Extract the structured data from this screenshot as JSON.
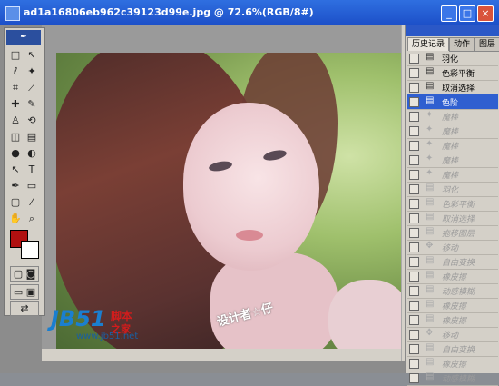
{
  "window": {
    "title": "ad1a16806eb962c39123d99e.jpg @ 72.6%(RGB/8#)",
    "controls": [
      "_",
      "□",
      "×"
    ]
  },
  "photo": {
    "signature": "设计者☆仔"
  },
  "toolbox": {
    "tools": [
      "marquee-tool",
      "move-tool",
      "lasso-tool",
      "magic-wand-tool",
      "crop-tool",
      "slice-tool",
      "healing-brush-tool",
      "brush-tool",
      "clone-stamp-tool",
      "history-brush-tool",
      "eraser-tool",
      "gradient-tool",
      "blur-tool",
      "dodge-tool",
      "path-select-tool",
      "type-tool",
      "pen-tool",
      "shape-tool",
      "notes-tool",
      "eyedropper-tool",
      "hand-tool",
      "zoom-tool"
    ],
    "glyphs": [
      "□",
      "↖",
      "ℓ",
      "✦",
      "⌗",
      "⟋",
      "✚",
      "✎",
      "♙",
      "⟲",
      "◫",
      "▤",
      "●",
      "◐",
      "↖",
      "T",
      "✒",
      "▭",
      "▢",
      "⁄",
      "✋",
      "⌕"
    ],
    "foreground_color": "#b01010",
    "background_color": "#ffffff"
  },
  "panel": {
    "tabs": [
      "历史记录",
      "动作",
      "图层"
    ],
    "history": [
      {
        "label": "羽化",
        "state": "normal"
      },
      {
        "label": "色彩平衡",
        "state": "normal"
      },
      {
        "label": "取消选择",
        "state": "normal"
      },
      {
        "label": "色阶",
        "state": "selected"
      },
      {
        "label": "魔棒",
        "state": "dim"
      },
      {
        "label": "魔棒",
        "state": "dim"
      },
      {
        "label": "魔棒",
        "state": "dim"
      },
      {
        "label": "魔棒",
        "state": "dim"
      },
      {
        "label": "魔棒",
        "state": "dim"
      },
      {
        "label": "羽化",
        "state": "dim"
      },
      {
        "label": "色彩平衡",
        "state": "dim"
      },
      {
        "label": "取消选择",
        "state": "dim"
      },
      {
        "label": "拖移图层",
        "state": "dim"
      },
      {
        "label": "移动",
        "state": "dim"
      },
      {
        "label": "自由变换",
        "state": "dim"
      },
      {
        "label": "橡皮擦",
        "state": "dim"
      },
      {
        "label": "动感模糊",
        "state": "dim"
      },
      {
        "label": "橡皮擦",
        "state": "dim"
      },
      {
        "label": "橡皮擦",
        "state": "dim"
      },
      {
        "label": "移动",
        "state": "dim"
      },
      {
        "label": "自由变换",
        "state": "dim"
      },
      {
        "label": "橡皮擦",
        "state": "dim"
      },
      {
        "label": "动感模糊",
        "state": "dim"
      }
    ]
  },
  "watermark": {
    "logo": "JB51",
    "line1": "脚本",
    "line2": "之家",
    "url": "www.jb51.net"
  }
}
